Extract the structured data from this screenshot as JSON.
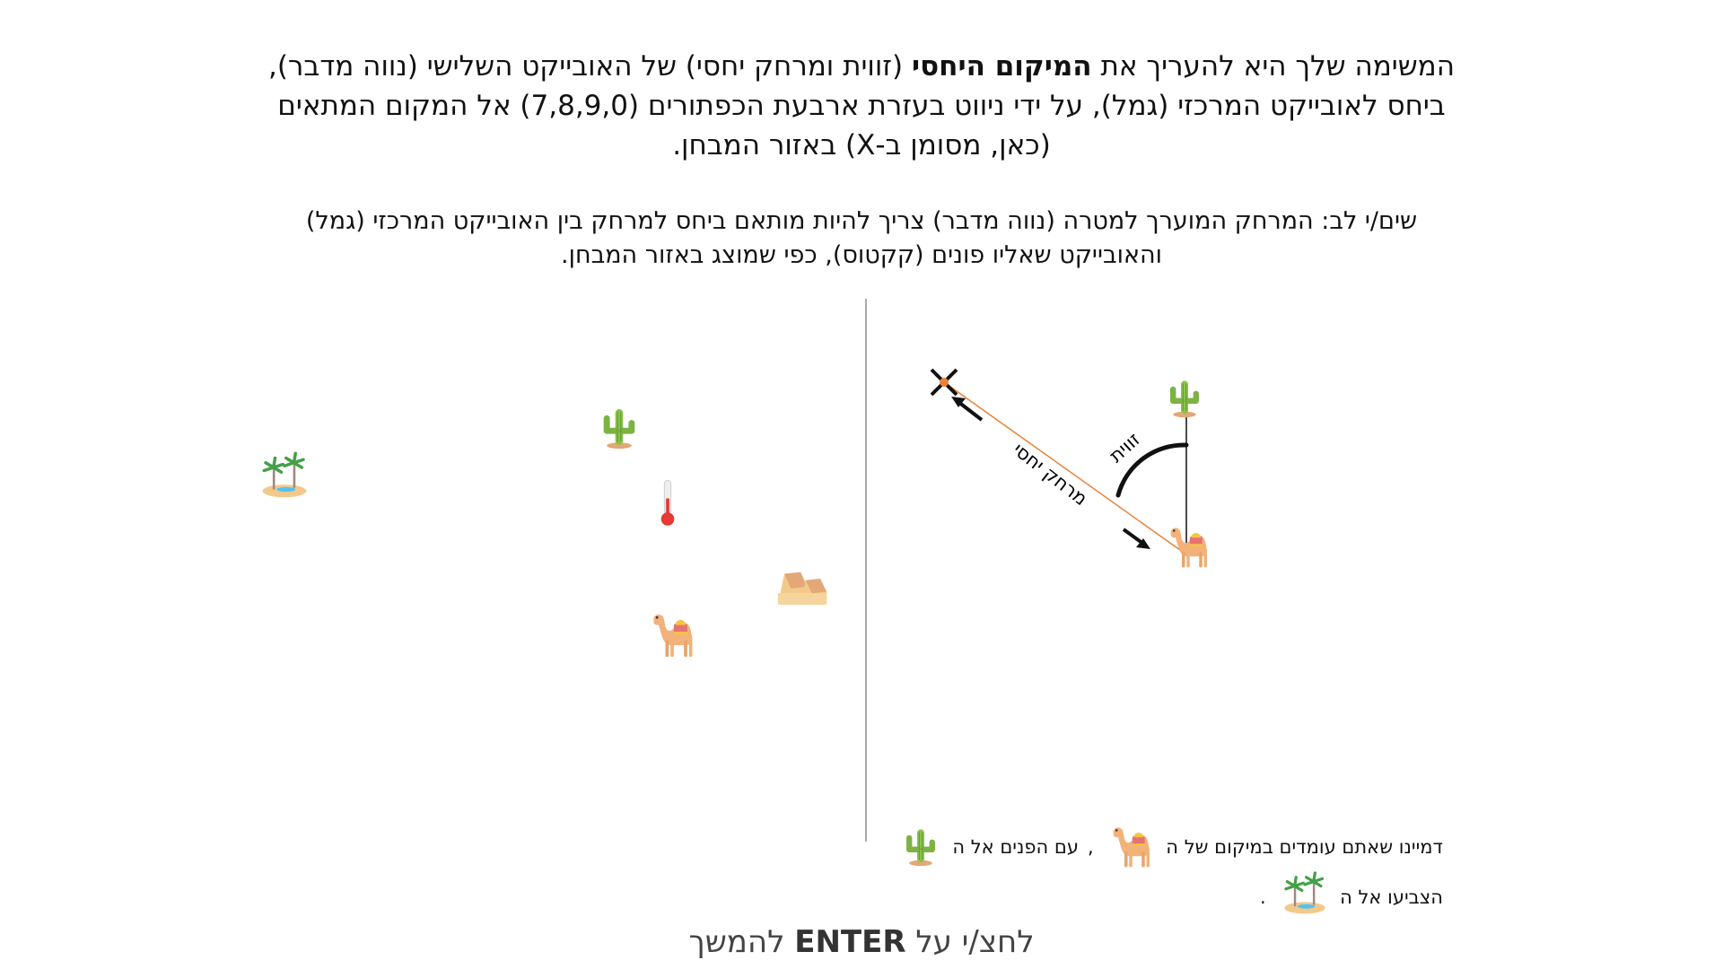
{
  "instructions": {
    "line1": "המשימה שלך היא להעריך את",
    "line1_bold": "המיקום היחסי",
    "line1_rest": "(זווית ומרחק יחסי) של האובייקט השלישי (נווה מדבר), ביחס לאובייקט המרכזי (גמל), על ידי ניווט בעזרת ארבעת הכפתורים (7,8,9,0) אל המקום המתאים (כאן, מסומן ב-X) באזור המבחן.",
    "note": "שים/י לב: המרחק המוערך למטרה (נווה מדבר) צריך להיות מותאם ביחס למרחק בין האובייקט המרכזי (גמל) והאובייקט שאליו פונים (קקטוס), כפי שמוצג באזור המבחן."
  },
  "example": {
    "angle_label": "זווית",
    "distance_label": "מרחק יחסי"
  },
  "captions": {
    "line1_part1": "דמיינו שאתם עומדים במיקום של ה",
    "line1_sep": ",",
    "line1_part2": "עם הפנים אל ה",
    "line2_part1": "הצביעו אל ה",
    "line2_end": "."
  },
  "footer": {
    "prefix": "לחצ/י על",
    "key": "ENTER",
    "suffix": "להמשך"
  },
  "icons": {
    "scene": [
      "oasis-icon",
      "cactus-icon",
      "thermometer-icon",
      "sand-dunes-icon",
      "camel-icon"
    ],
    "example": [
      "x-mark-icon",
      "cactus-icon",
      "camel-icon",
      "arrow-icon"
    ],
    "captions": [
      "camel-icon",
      "cactus-icon",
      "oasis-icon"
    ]
  },
  "colors": {
    "distance_line": "#e8833a",
    "cactus": "#8bc34a",
    "camel": "#f2b27a",
    "sand": "#f3c98b"
  }
}
